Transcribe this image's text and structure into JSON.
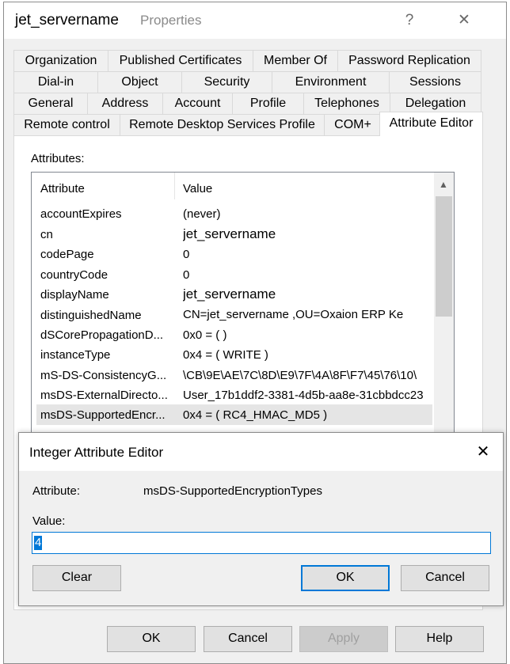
{
  "window": {
    "title": "jet_servername",
    "title_suffix": "Properties",
    "help_btn": "?",
    "close_btn": "✕"
  },
  "tabs": {
    "row1": [
      "Organization",
      "Published Certificates",
      "Member Of",
      "Password Replication"
    ],
    "row2": [
      "Dial-in",
      "Object",
      "Security",
      "Environment",
      "Sessions"
    ],
    "row3": [
      "General",
      "Address",
      "Account",
      "Profile",
      "Telephones",
      "Delegation"
    ],
    "row4": [
      "Remote control",
      "Remote Desktop Services Profile",
      "COM+",
      "Attribute Editor"
    ]
  },
  "attributes_label": "Attributes:",
  "list": {
    "col_attribute": "Attribute",
    "col_value": "Value",
    "rows": [
      {
        "name": "accountExpires",
        "value": "(never)"
      },
      {
        "name": "cn",
        "value": "jet_servername"
      },
      {
        "name": "codePage",
        "value": "0"
      },
      {
        "name": "countryCode",
        "value": "0"
      },
      {
        "name": "displayName",
        "value": "jet_servername"
      },
      {
        "name": "distinguishedName",
        "value": "CN=jet_servername ,OU=Oxaion ERP Ke"
      },
      {
        "name": "dSCorePropagationD...",
        "value": "0x0 = (  )"
      },
      {
        "name": "instanceType",
        "value": "0x4 = ( WRITE )"
      },
      {
        "name": "mS-DS-ConsistencyG...",
        "value": "\\CB\\9E\\AE\\7C\\8D\\E9\\7F\\4A\\8F\\F7\\45\\76\\10\\"
      },
      {
        "name": "msDS-ExternalDirecto...",
        "value": "User_17b1ddf2-3381-4d5b-aa8e-31cbbdcc23"
      },
      {
        "name": "msDS-SupportedEncr...",
        "value": "0x4 = ( RC4_HMAC_MD5 )"
      }
    ]
  },
  "buttons": {
    "ok": "OK",
    "cancel": "Cancel",
    "apply": "Apply",
    "help": "Help"
  },
  "dialog": {
    "title": "Integer Attribute Editor",
    "close": "✕",
    "attribute_label": "Attribute:",
    "attribute_value": "msDS-SupportedEncryptionTypes",
    "value_label": "Value:",
    "value_input": "4",
    "clear": "Clear",
    "ok": "OK",
    "cancel": "Cancel"
  },
  "colors": {
    "accent": "#0078d7",
    "window_bg": "#f0f0f0",
    "selected_row": "#e5e5e5"
  }
}
